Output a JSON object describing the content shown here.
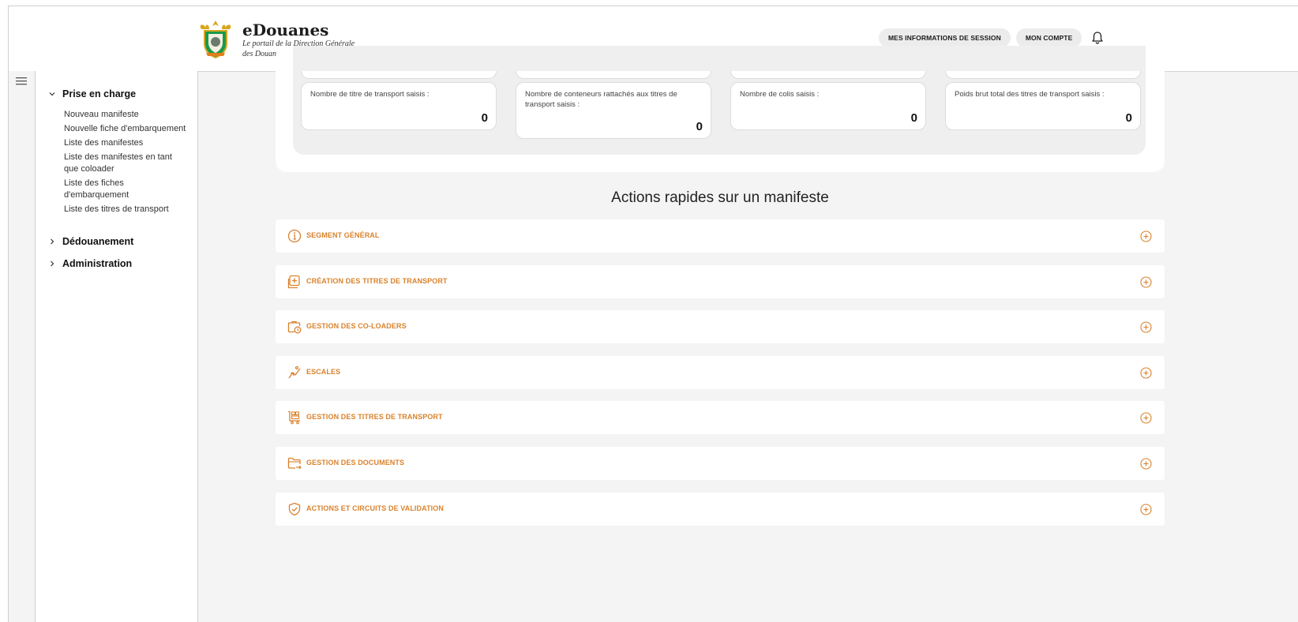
{
  "header": {
    "app_title": "eDouanes",
    "subtitle_line1": "Le portail de la Direction Générale",
    "subtitle_line2": "des Douanes de Côte d'Ivoire",
    "session_info_button": "MES INFORMATIONS DE SESSION",
    "account_button": "MON COMPTE"
  },
  "sidebar": {
    "sections": [
      {
        "label": "Prise en charge",
        "expanded": true,
        "items": [
          "Nouveau manifeste",
          "Nouvelle fiche d'embarquement",
          "Liste des manifestes",
          "Liste des manifestes en tant que coloader",
          "Liste des fiches d'embarquement",
          "Liste des titres de transport"
        ]
      },
      {
        "label": "Dédouanement",
        "expanded": false
      },
      {
        "label": "Administration",
        "expanded": false
      }
    ]
  },
  "stats": [
    {
      "label": "Nombre de titre de transport saisis :",
      "value": "0"
    },
    {
      "label": "Nombre de conteneurs rattachés aux titres de transport saisis :",
      "value": "0"
    },
    {
      "label": "Nombre de colis saisis :",
      "value": "0"
    },
    {
      "label": "Poids brut total des titres de transport saisis :",
      "value": "0"
    }
  ],
  "quick_actions": {
    "title": "Actions rapides sur un manifeste",
    "items": [
      {
        "label": "SEGMENT GÉNÉRAL",
        "icon": "info-icon"
      },
      {
        "label": "CRÉATION DES TITRES DE TRANSPORT",
        "icon": "add-document-icon"
      },
      {
        "label": "GESTION DES CO-LOADERS",
        "icon": "briefcase-clock-icon"
      },
      {
        "label": "ESCALES",
        "icon": "ship-escale-icon"
      },
      {
        "label": "GESTION DES TITRES DE TRANSPORT",
        "icon": "cart-grid-icon"
      },
      {
        "label": "GESTION DES DOCUMENTS",
        "icon": "folder-arrow-icon"
      },
      {
        "label": "ACTIONS ET CIRCUITS DE VALIDATION",
        "icon": "shield-check-icon"
      }
    ]
  },
  "colors": {
    "accent": "#d9822b",
    "background": "#f4f4f4",
    "card": "#ffffff"
  }
}
